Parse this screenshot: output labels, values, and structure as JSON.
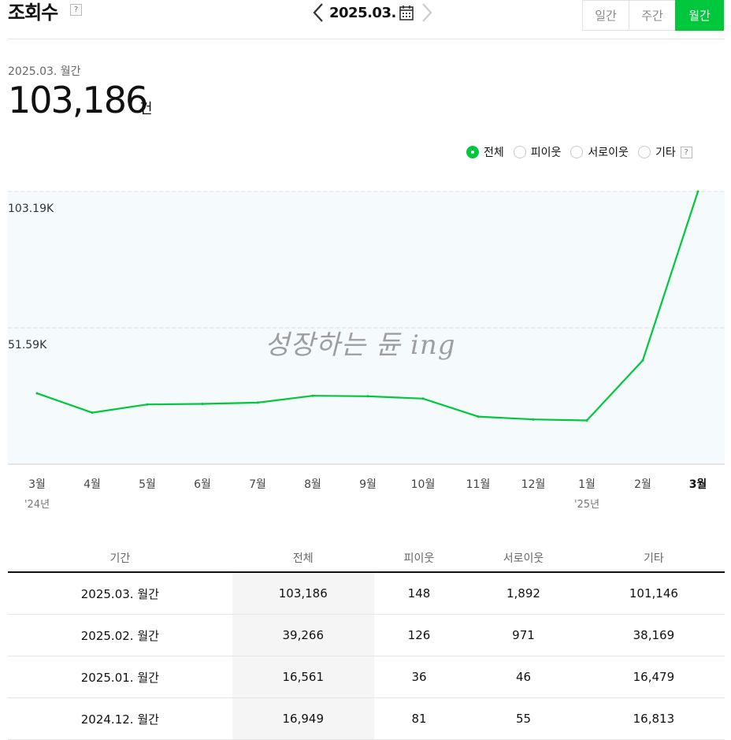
{
  "header": {
    "title": "조회수",
    "help_label": "?",
    "date": "2025.03.",
    "tabs": [
      {
        "label": "일간",
        "active": false
      },
      {
        "label": "주간",
        "active": false
      },
      {
        "label": "월간",
        "active": true
      }
    ]
  },
  "summary": {
    "period": "2025.03. 월간",
    "value": "103,186",
    "unit": "건"
  },
  "legend": {
    "items": [
      {
        "label": "전체",
        "selected": true
      },
      {
        "label": "피이웃",
        "selected": false
      },
      {
        "label": "서로이웃",
        "selected": false
      },
      {
        "label": "기타",
        "selected": false
      }
    ],
    "help_label": "?"
  },
  "watermark": "성장하는 듄 ing",
  "colors": {
    "accent": "#00c73c",
    "chart_bg": "#f5fafd",
    "gridline": "#dfe9ef"
  },
  "icons": {
    "prev": "chevron-left-icon",
    "next": "chevron-right-icon",
    "calendar": "calendar-icon"
  },
  "chart_data": {
    "type": "line",
    "categories": [
      "3월",
      "4월",
      "5월",
      "6월",
      "7월",
      "8월",
      "9월",
      "10월",
      "11월",
      "12월",
      "1월",
      "2월",
      "3월"
    ],
    "year_labels": {
      "0": "'24년",
      "10": "'25년"
    },
    "highlight_index": 12,
    "series": [
      {
        "values": [
          26800,
          19500,
          22600,
          22800,
          23300,
          25900,
          25700,
          24800,
          18000,
          16949,
          16561,
          39266,
          103186
        ]
      }
    ],
    "y_ticks": [
      {
        "value": 103186,
        "label": "103.19K"
      },
      {
        "value": 51593,
        "label": "51.59K"
      }
    ],
    "ylim": [
      0,
      103186
    ]
  },
  "table": {
    "headers": [
      "기간",
      "전체",
      "피이웃",
      "서로이웃",
      "기타"
    ],
    "rows": [
      [
        "2025.03. 월간",
        "103,186",
        "148",
        "1,892",
        "101,146"
      ],
      [
        "2025.02. 월간",
        "39,266",
        "126",
        "971",
        "38,169"
      ],
      [
        "2025.01. 월간",
        "16,561",
        "36",
        "46",
        "16,479"
      ],
      [
        "2024.12. 월간",
        "16,949",
        "81",
        "55",
        "16,813"
      ]
    ]
  }
}
